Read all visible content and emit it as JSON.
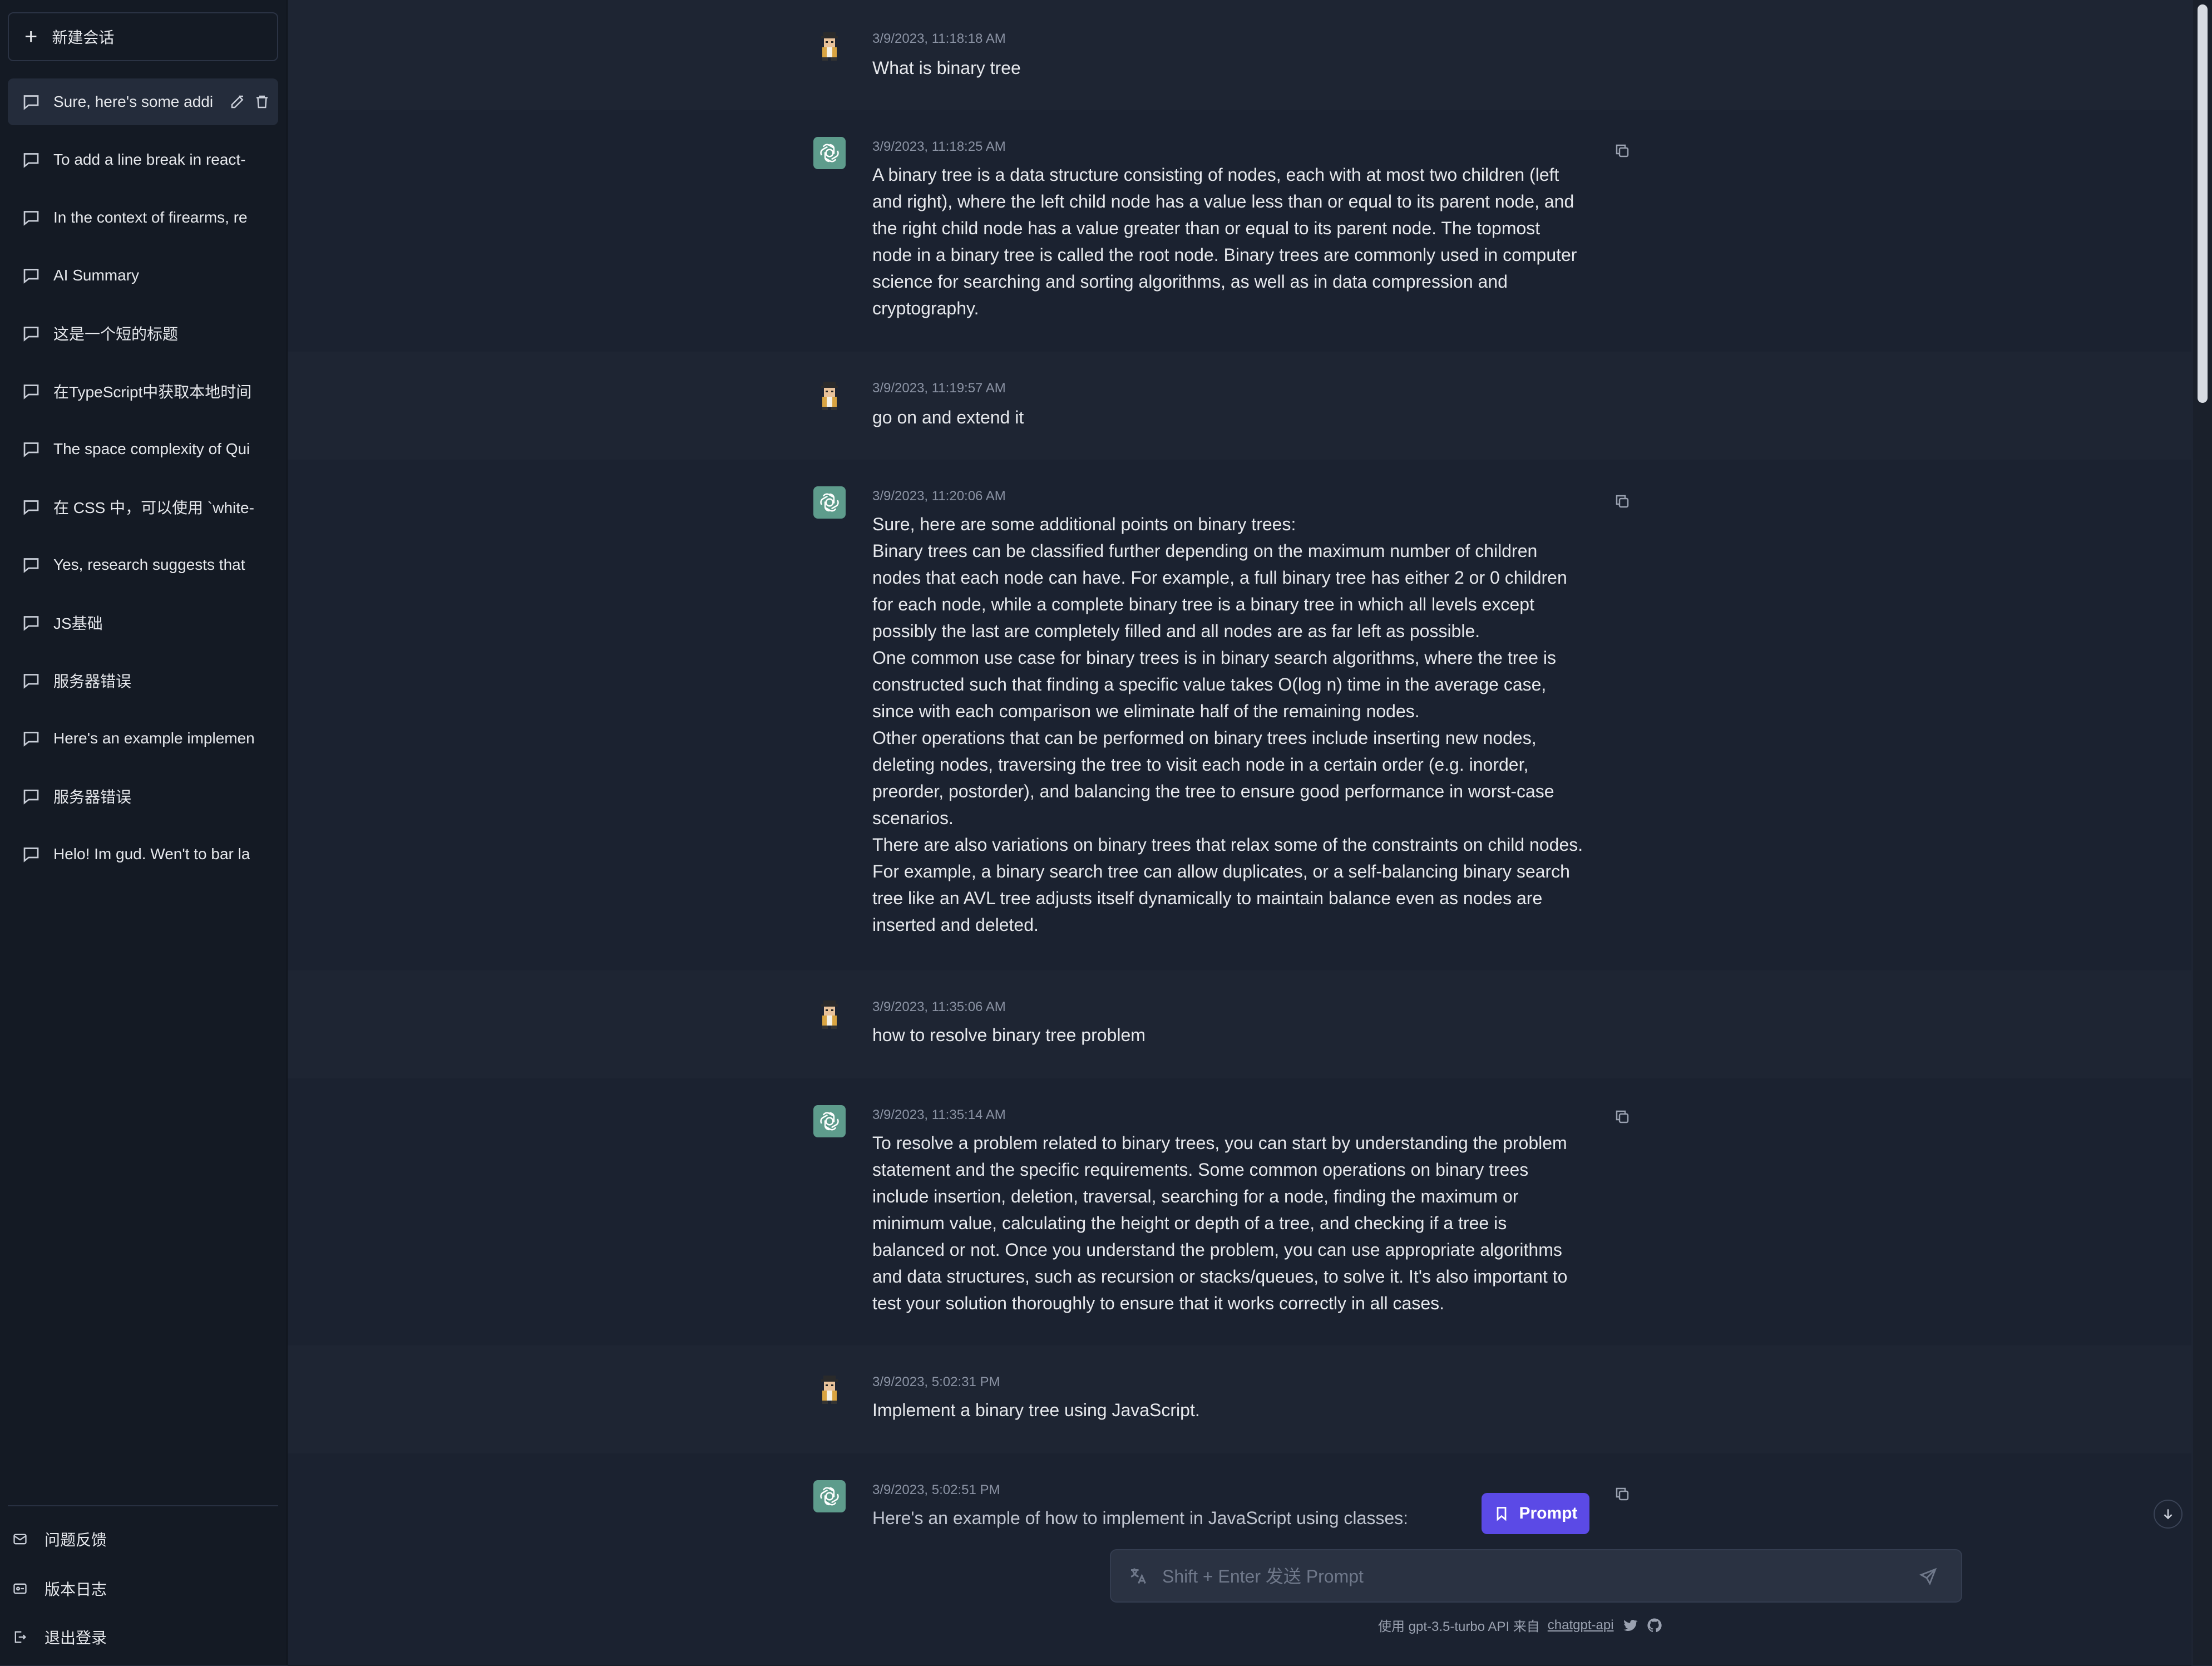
{
  "sidebar": {
    "new_chat_label": "新建会话",
    "conversations": [
      {
        "label": "Sure, here's some addi",
        "active": true
      },
      {
        "label": "To add a line break in react-"
      },
      {
        "label": "In the context of firearms, re"
      },
      {
        "label": "AI Summary"
      },
      {
        "label": "这是一个短的标题"
      },
      {
        "label": "在TypeScript中获取本地时间"
      },
      {
        "label": "The space complexity of Qui"
      },
      {
        "label": "在 CSS 中，可以使用 `white-"
      },
      {
        "label": "Yes, research suggests that"
      },
      {
        "label": "JS基础"
      },
      {
        "label": "服务器错误"
      },
      {
        "label": "Here's an example implemen"
      },
      {
        "label": "服务器错误"
      },
      {
        "label": "Helo! Im gud. Wen't to bar la"
      }
    ],
    "footer": {
      "feedback": "问题反馈",
      "changelog": "版本日志",
      "logout": "退出登录"
    }
  },
  "messages": [
    {
      "role": "user",
      "time": "3/9/2023, 11:18:18 AM",
      "text": "What is binary tree"
    },
    {
      "role": "assistant",
      "time": "3/9/2023, 11:18:25 AM",
      "text": "A binary tree is a data structure consisting of nodes, each with at most two children (left\nand right), where the left child node has a value less than or equal to its parent node, and\nthe right child node has a value greater than or equal to its parent node. The topmost\nnode in a binary tree is called the root node. Binary trees are commonly used in computer\nscience for searching and sorting algorithms, as well as in data compression and\ncryptography."
    },
    {
      "role": "user",
      "time": "3/9/2023, 11:19:57 AM",
      "text": "go on and extend it"
    },
    {
      "role": "assistant",
      "time": "3/9/2023, 11:20:06 AM",
      "text": "Sure, here are some additional points on binary trees:\nBinary trees can be classified further depending on the maximum number of children\nnodes that each node can have. For example, a full binary tree has either 2 or 0 children\nfor each node, while a complete binary tree is a binary tree in which all levels except\npossibly the last are completely filled and all nodes are as far left as possible.\nOne common use case for binary trees is in binary search algorithms, where the tree is\nconstructed such that finding a specific value takes O(log n) time in the average case,\nsince with each comparison we eliminate half of the remaining nodes.\nOther operations that can be performed on binary trees include inserting new nodes,\ndeleting nodes, traversing the tree to visit each node in a certain order (e.g. inorder,\npreorder, postorder), and balancing the tree to ensure good performance in worst-case\nscenarios.\nThere are also variations on binary trees that relax some of the constraints on child nodes.\nFor example, a binary search tree can allow duplicates, or a self-balancing binary search\ntree like an AVL tree adjusts itself dynamically to maintain balance even as nodes are\ninserted and deleted."
    },
    {
      "role": "user",
      "time": "3/9/2023, 11:35:06 AM",
      "text": "how to resolve binary tree problem"
    },
    {
      "role": "assistant",
      "time": "3/9/2023, 11:35:14 AM",
      "text": "To resolve a problem related to binary trees, you can start by understanding the problem\nstatement and the specific requirements. Some common operations on binary trees\ninclude insertion, deletion, traversal, searching for a node, finding the maximum or\nminimum value, calculating the height or depth of a tree, and checking if a tree is\nbalanced or not. Once you understand the problem, you can use appropriate algorithms\nand data structures, such as recursion or stacks/queues, to solve it. It's also important to\ntest your solution thoroughly to ensure that it works correctly in all cases."
    },
    {
      "role": "user",
      "time": "3/9/2023, 5:02:31 PM",
      "text": "Implement a binary tree using JavaScript."
    },
    {
      "role": "assistant",
      "time": "3/9/2023, 5:02:51 PM",
      "text": "Here's an example of how to implement                   in JavaScript using classes:"
    }
  ],
  "prompt_button": "Prompt",
  "input": {
    "placeholder": "Shift + Enter 发送 Prompt",
    "value": ""
  },
  "footer": {
    "prefix": "使用 gpt-3.5-turbo API 来自",
    "link": "chatgpt-api"
  },
  "colors": {
    "accent": "#5b4ae6",
    "bot_avatar": "#5e9c8c",
    "sidebar_bg": "#141a24",
    "main_bg": "#1e2533"
  }
}
